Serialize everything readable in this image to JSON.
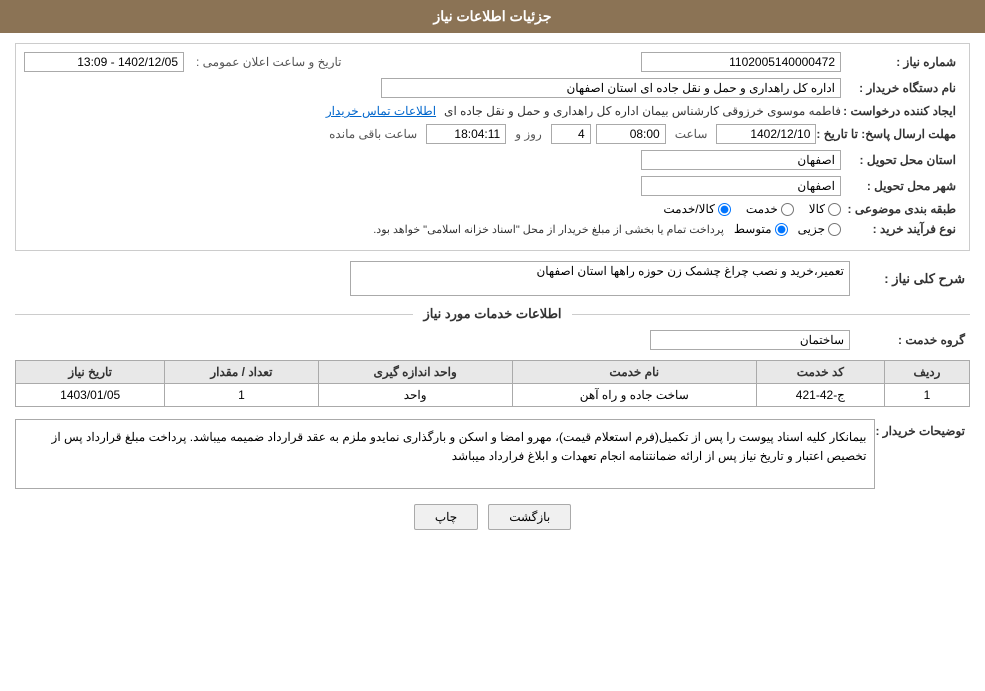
{
  "page": {
    "title": "جزئیات اطلاعات نیاز",
    "header": {
      "bg_color": "#8B7355",
      "text": "جزئیات اطلاعات نیاز"
    }
  },
  "form": {
    "need_number_label": "شماره نیاز :",
    "need_number_value": "1102005140000472",
    "announce_datetime_label": "تاریخ و ساعت اعلان عمومی :",
    "announce_datetime_value": "1402/12/05 - 13:09",
    "buyer_org_label": "نام دستگاه خریدار :",
    "buyer_org_value": "اداره کل راهداری و حمل و نقل جاده ای استان اصفهان",
    "creator_label": "ایجاد کننده درخواست :",
    "creator_value": "فاطمه موسوی خرزوقی کارشناس بیمان اداره کل راهداری و حمل و نقل جاده ای",
    "creator_link": "اطلاعات تماس خریدار",
    "response_deadline_label": "مهلت ارسال پاسخ: تا تاریخ :",
    "response_date_value": "1402/12/10",
    "response_time_label": "ساعت",
    "response_time_value": "08:00",
    "response_days_label": "روز و",
    "response_days_value": "4",
    "remaining_time_label": "ساعت باقی مانده",
    "remaining_time_value": "18:04:11",
    "delivery_province_label": "استان محل تحویل :",
    "delivery_province_value": "اصفهان",
    "delivery_city_label": "شهر محل تحویل :",
    "delivery_city_value": "اصفهان",
    "category_label": "طبقه بندی موضوعی :",
    "category_options": [
      {
        "label": "کالا",
        "value": "kala",
        "selected": false
      },
      {
        "label": "خدمت",
        "value": "khedmat",
        "selected": false
      },
      {
        "label": "کالا/خدمت",
        "value": "kala_khedmat",
        "selected": true
      }
    ],
    "process_type_label": "نوع فرآیند خرید :",
    "process_options": [
      {
        "label": "جزیی",
        "value": "jozi",
        "selected": false
      },
      {
        "label": "متوسط",
        "value": "motavaset",
        "selected": true
      },
      {
        "label": "process_note",
        "value": "پرداخت تمام یا بخشی از مبلغ خریدار از محل \"اسناد خزانه اسلامی\" خواهد بود.",
        "selected": false
      }
    ],
    "description_label": "شرح کلی نیاز :",
    "description_value": "تعمیر،خرید و نصب چراغ چشمک زن حوزه راهها استان اصفهان",
    "services_info_title": "اطلاعات خدمات مورد نیاز",
    "service_group_label": "گروه خدمت :",
    "service_group_value": "ساختمان",
    "table": {
      "headers": [
        "ردیف",
        "کد خدمت",
        "نام خدمت",
        "واحد اندازه گیری",
        "تعداد / مقدار",
        "تاریخ نیاز"
      ],
      "rows": [
        {
          "row_num": "1",
          "service_code": "ج-42-421",
          "service_name": "ساخت جاده و راه آهن",
          "unit": "واحد",
          "quantity": "1",
          "date": "1403/01/05"
        }
      ]
    },
    "buyer_notes_label": "توضیحات خریدار :",
    "buyer_notes_value": "بیمانکار کلیه اسناد پیوست را پس از تکمیل(فرم استعلام قیمت)، مهرو امضا و اسکن و بارگذاری نمایدو ملزم به عقد قرارداد ضمیمه میباشد. پرداخت مبلغ قرارداد پس از تخصیص اعتبار و تاریخ نیاز پس از ارائه ضمانتنامه انجام تعهدات و ابلاغ فرارداد میباشد",
    "btn_back": "بازگشت",
    "btn_print": "چاپ"
  }
}
